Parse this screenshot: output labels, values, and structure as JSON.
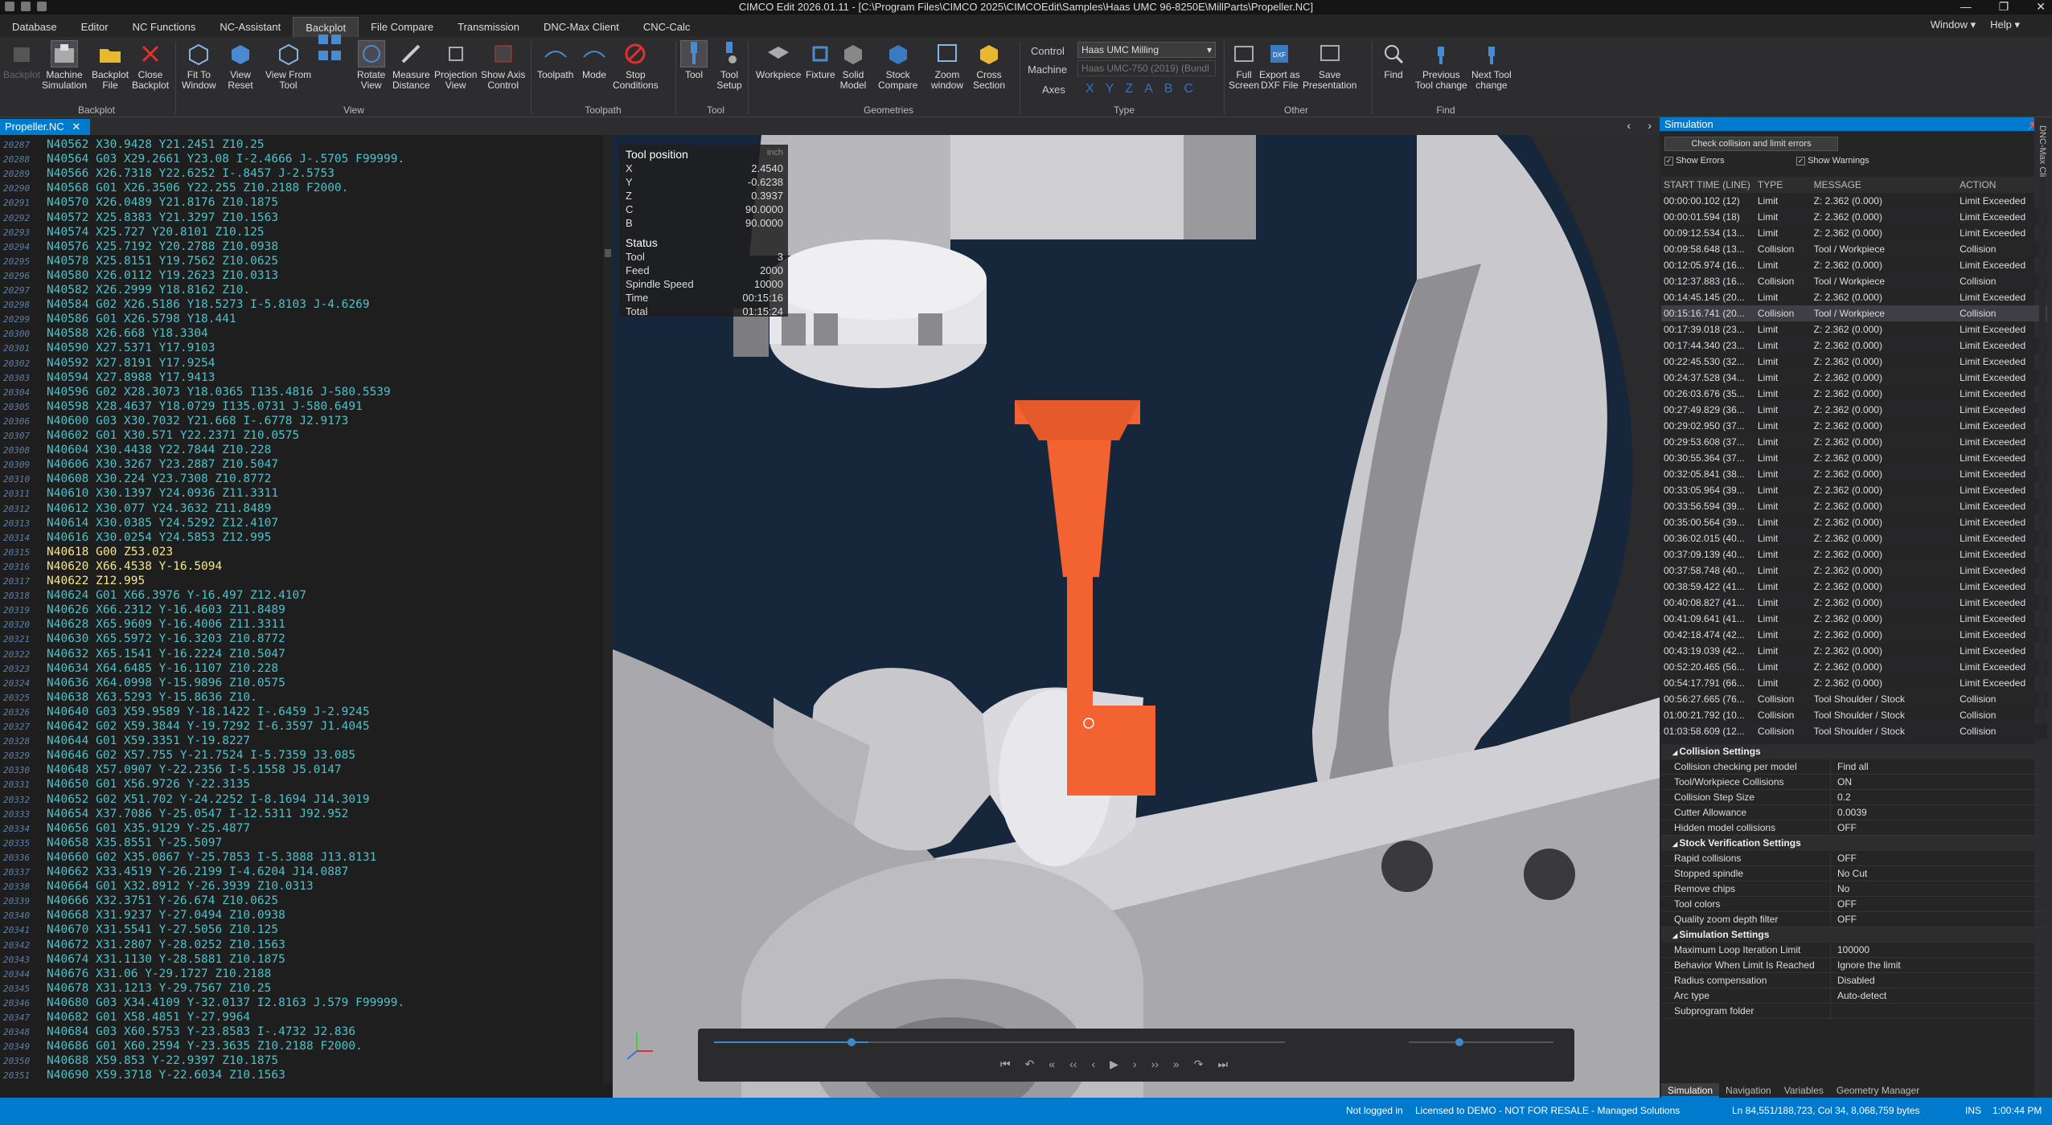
{
  "window": {
    "title": "CIMCO Edit 2026.01.11 - [C:\\Program Files\\CIMCO 2025\\CIMCOEdit\\Samples\\Haas UMC 96-8250E\\MillParts\\Propeller.NC]",
    "minimize": "—",
    "maximize": "❐",
    "close": "✕"
  },
  "menu": {
    "tabs": [
      "Database",
      "Editor",
      "NC Functions",
      "NC-Assistant",
      "Backplot",
      "File Compare",
      "Transmission",
      "DNC-Max Client",
      "CNC-Calc"
    ],
    "window_label": "Window",
    "help_label": "Help"
  },
  "ribbon": {
    "buttons": [
      {
        "label": "Backplot",
        "label2": ""
      },
      {
        "label": "Machine",
        "label2": "Simulation"
      },
      {
        "label": "Backplot",
        "label2": "File"
      },
      {
        "label": "Close",
        "label2": "Backplot"
      },
      {
        "label": "Fit To",
        "label2": "Window"
      },
      {
        "label": "View",
        "label2": "Reset"
      },
      {
        "label": "View From",
        "label2": "Tool"
      },
      {
        "label": "Rotate",
        "label2": "View"
      },
      {
        "label": "Measure",
        "label2": "Distance"
      },
      {
        "label": "Projection",
        "label2": "View"
      },
      {
        "label": "Show Axis",
        "label2": "Control"
      },
      {
        "label": "Toolpath",
        "label2": ""
      },
      {
        "label": "Mode",
        "label2": ""
      },
      {
        "label": "Stop",
        "label2": "Conditions"
      },
      {
        "label": "Tool",
        "label2": ""
      },
      {
        "label": "Tool",
        "label2": "Setup"
      },
      {
        "label": "Workpiece",
        "label2": ""
      },
      {
        "label": "Fixture",
        "label2": ""
      },
      {
        "label": "Solid",
        "label2": "Model"
      },
      {
        "label": "Stock",
        "label2": "Compare"
      },
      {
        "label": "Zoom",
        "label2": "window"
      },
      {
        "label": "Cross",
        "label2": "Section"
      },
      {
        "label": "Full",
        "label2": "Screen"
      },
      {
        "label": "Export as",
        "label2": "DXF File"
      },
      {
        "label": "Save",
        "label2": "Presentation"
      },
      {
        "label": "Find",
        "label2": ""
      },
      {
        "label": "Previous",
        "label2": "Tool change"
      },
      {
        "label": "Next Tool",
        "label2": "change"
      }
    ],
    "groups": [
      "Backplot",
      "View",
      "Toolpath",
      "Tool",
      "Geometries",
      "Type",
      "Other",
      "Find"
    ],
    "control_label": "Control",
    "control_value": "Haas UMC Milling",
    "machine_label": "Machine",
    "machine_value": "Haas UMC-750 (2019) (Bundl",
    "axes_label": "Axes",
    "axes": [
      "X",
      "Y",
      "Z",
      "A",
      "B",
      "C"
    ]
  },
  "editor": {
    "tab": "Propeller.NC",
    "close": "✕",
    "lines": [
      {
        "n": "20287",
        "t": "N40562 X30.9428 Y21.2451 Z10.25",
        "y": false
      },
      {
        "n": "20288",
        "t": "N40564 G03 X29.2661 Y23.08 I-2.4666 J-.5705 F99999.",
        "y": false
      },
      {
        "n": "20289",
        "t": "N40566 X26.7318 Y22.6252 I-.8457 J-2.5753",
        "y": false
      },
      {
        "n": "20290",
        "t": "N40568 G01 X26.3506 Y22.255 Z10.2188 F2000.",
        "y": false
      },
      {
        "n": "20291",
        "t": "N40570 X26.0489 Y21.8176 Z10.1875",
        "y": false
      },
      {
        "n": "20292",
        "t": "N40572 X25.8383 Y21.3297 Z10.1563",
        "y": false
      },
      {
        "n": "20293",
        "t": "N40574 X25.727 Y20.8101 Z10.125",
        "y": false
      },
      {
        "n": "20294",
        "t": "N40576 X25.7192 Y20.2788 Z10.0938",
        "y": false
      },
      {
        "n": "20295",
        "t": "N40578 X25.8151 Y19.7562 Z10.0625",
        "y": false
      },
      {
        "n": "20296",
        "t": "N40580 X26.0112 Y19.2623 Z10.0313",
        "y": false
      },
      {
        "n": "20297",
        "t": "N40582 X26.2999 Y18.8162 Z10.",
        "y": false
      },
      {
        "n": "20298",
        "t": "N40584 G02 X26.5186 Y18.5273 I-5.8103 J-4.6269",
        "y": false
      },
      {
        "n": "20299",
        "t": "N40586 G01 X26.5798 Y18.441",
        "y": false
      },
      {
        "n": "20300",
        "t": "N40588 X26.668 Y18.3304",
        "y": false
      },
      {
        "n": "20301",
        "t": "N40590 X27.5371 Y17.9103",
        "y": false
      },
      {
        "n": "20302",
        "t": "N40592 X27.8191 Y17.9254",
        "y": false
      },
      {
        "n": "20303",
        "t": "N40594 X27.8988 Y17.9413",
        "y": false
      },
      {
        "n": "20304",
        "t": "N40596 G02 X28.3073 Y18.0365 I135.4816 J-580.5539",
        "y": false
      },
      {
        "n": "20305",
        "t": "N40598 X28.4637 Y18.0729 I135.0731 J-580.6491",
        "y": false
      },
      {
        "n": "20306",
        "t": "N40600 G03 X30.7032 Y21.668 I-.6778 J2.9173",
        "y": false
      },
      {
        "n": "20307",
        "t": "N40602 G01 X30.571 Y22.2371 Z10.0575",
        "y": false
      },
      {
        "n": "20308",
        "t": "N40604 X30.4438 Y22.7844 Z10.228",
        "y": false
      },
      {
        "n": "20309",
        "t": "N40606 X30.3267 Y23.2887 Z10.5047",
        "y": false
      },
      {
        "n": "20310",
        "t": "N40608 X30.224 Y23.7308 Z10.8772",
        "y": false
      },
      {
        "n": "20311",
        "t": "N40610 X30.1397 Y24.0936 Z11.3311",
        "y": false
      },
      {
        "n": "20312",
        "t": "N40612 X30.077 Y24.3632 Z11.8489",
        "y": false
      },
      {
        "n": "20313",
        "t": "N40614 X30.0385 Y24.5292 Z12.4107",
        "y": false
      },
      {
        "n": "20314",
        "t": "N40616 X30.0254 Y24.5853 Z12.995",
        "y": false
      },
      {
        "n": "20315",
        "t": "N40618 G00 Z53.023",
        "y": true
      },
      {
        "n": "20316",
        "t": "N40620 X66.4538 Y-16.5094",
        "y": true
      },
      {
        "n": "20317",
        "t": "N40622 Z12.995",
        "y": true
      },
      {
        "n": "20318",
        "t": "N40624 G01 X66.3976 Y-16.497 Z12.4107",
        "y": false
      },
      {
        "n": "20319",
        "t": "N40626 X66.2312 Y-16.4603 Z11.8489",
        "y": false
      },
      {
        "n": "20320",
        "t": "N40628 X65.9609 Y-16.4006 Z11.3311",
        "y": false
      },
      {
        "n": "20321",
        "t": "N40630 X65.5972 Y-16.3203 Z10.8772",
        "y": false
      },
      {
        "n": "20322",
        "t": "N40632 X65.1541 Y-16.2224 Z10.5047",
        "y": false
      },
      {
        "n": "20323",
        "t": "N40634 X64.6485 Y-16.1107 Z10.228",
        "y": false
      },
      {
        "n": "20324",
        "t": "N40636 X64.0998 Y-15.9896 Z10.0575",
        "y": false
      },
      {
        "n": "20325",
        "t": "N40638 X63.5293 Y-15.8636 Z10.",
        "y": false
      },
      {
        "n": "20326",
        "t": "N40640 G03 X59.9589 Y-18.1422 I-.6459 J-2.9245",
        "y": false
      },
      {
        "n": "20327",
        "t": "N40642 G02 X59.3844 Y-19.7292 I-6.3597 J1.4045",
        "y": false
      },
      {
        "n": "20328",
        "t": "N40644 G01 X59.3351 Y-19.8227",
        "y": false
      },
      {
        "n": "20329",
        "t": "N40646 G02 X57.755 Y-21.7524 I-5.7359 J3.085",
        "y": false
      },
      {
        "n": "20330",
        "t": "N40648 X57.0907 Y-22.2356 I-5.1558 J5.0147",
        "y": false
      },
      {
        "n": "20331",
        "t": "N40650 G01 X56.9726 Y-22.3135",
        "y": false
      },
      {
        "n": "20332",
        "t": "N40652 G02 X51.702 Y-24.2252 I-8.1694 J14.3019",
        "y": false
      },
      {
        "n": "20333",
        "t": "N40654 X37.7086 Y-25.0547 I-12.5311 J92.952",
        "y": false
      },
      {
        "n": "20334",
        "t": "N40656 G01 X35.9129 Y-25.4877",
        "y": false
      },
      {
        "n": "20335",
        "t": "N40658 X35.8551 Y-25.5097",
        "y": false
      },
      {
        "n": "20336",
        "t": "N40660 G02 X35.0867 Y-25.7853 I-5.3888 J13.8131",
        "y": false
      },
      {
        "n": "20337",
        "t": "N40662 X33.4519 Y-26.2199 I-4.6204 J14.0887",
        "y": false
      },
      {
        "n": "20338",
        "t": "N40664 G01 X32.8912 Y-26.3939 Z10.0313",
        "y": false
      },
      {
        "n": "20339",
        "t": "N40666 X32.3751 Y-26.674 Z10.0625",
        "y": false
      },
      {
        "n": "20340",
        "t": "N40668 X31.9237 Y-27.0494 Z10.0938",
        "y": false
      },
      {
        "n": "20341",
        "t": "N40670 X31.5541 Y-27.5056 Z10.125",
        "y": false
      },
      {
        "n": "20342",
        "t": "N40672 X31.2807 Y-28.0252 Z10.1563",
        "y": false
      },
      {
        "n": "20343",
        "t": "N40674 X31.1130 Y-28.5881 Z10.1875",
        "y": false
      },
      {
        "n": "20344",
        "t": "N40676 X31.06 Y-29.1727 Z10.2188",
        "y": false
      },
      {
        "n": "20345",
        "t": "N40678 X31.1213 Y-29.7567 Z10.25",
        "y": false
      },
      {
        "n": "20346",
        "t": "N40680 G03 X34.4109 Y-32.0137 I2.8163 J.579 F99999.",
        "y": false
      },
      {
        "n": "20347",
        "t": "N40682 G01 X58.4851 Y-27.9964",
        "y": false
      },
      {
        "n": "20348",
        "t": "N40684 G03 X60.5753 Y-23.8583 I-.4732 J2.836",
        "y": false
      },
      {
        "n": "20349",
        "t": "N40686 G01 X60.2594 Y-23.3635 Z10.2188 F2000.",
        "y": false
      },
      {
        "n": "20350",
        "t": "N40688 X59.853 Y-22.9397 Z10.1875",
        "y": false
      },
      {
        "n": "20351",
        "t": "N40690 X59.3718 Y-22.6034 Z10.1563",
        "y": false
      }
    ]
  },
  "toolpos": {
    "title": "Tool position",
    "unit": "inch",
    "rows": [
      [
        "X",
        "2.4540"
      ],
      [
        "Y",
        "-0.6238"
      ],
      [
        "Z",
        "0.3937"
      ],
      [
        "C",
        "90.0000"
      ],
      [
        "B",
        "90.0000"
      ]
    ],
    "status_title": "Status",
    "status": [
      [
        "Tool",
        "3"
      ],
      [
        "Feed",
        "2000"
      ],
      [
        "Spindle Speed",
        "10000"
      ],
      [
        "Time",
        "00:15:16"
      ],
      [
        "Total",
        "01:15:24"
      ]
    ]
  },
  "simulation": {
    "title": "Simulation",
    "check_button": "Check collision and limit errors",
    "show_errors": "Show Errors",
    "show_warnings": "Show Warnings",
    "side_tab": "DNC-Max Client",
    "columns": [
      "START TIME (LINE)",
      "TYPE",
      "MESSAGE",
      "ACTION"
    ],
    "rows": [
      [
        "00:00:00.102 (12)",
        "Limit",
        "Z: 2.362 (0.000)",
        "Limit Exceeded"
      ],
      [
        "00:00:01.594 (18)",
        "Limit",
        "Z: 2.362 (0.000)",
        "Limit Exceeded"
      ],
      [
        "00:09:12.534 (13...",
        "Limit",
        "Z: 2.362 (0.000)",
        "Limit Exceeded"
      ],
      [
        "00:09:58.648 (13...",
        "Collision",
        "Tool / Workpiece",
        "Collision"
      ],
      [
        "00:12:05.974 (16...",
        "Limit",
        "Z: 2.362 (0.000)",
        "Limit Exceeded"
      ],
      [
        "00:12:37.883 (16...",
        "Collision",
        "Tool / Workpiece",
        "Collision"
      ],
      [
        "00:14:45.145 (20...",
        "Limit",
        "Z: 2.362 (0.000)",
        "Limit Exceeded"
      ],
      [
        "00:15:16.741 (20...",
        "Collision",
        "Tool / Workpiece",
        "Collision"
      ],
      [
        "00:17:39.018 (23...",
        "Limit",
        "Z: 2.362 (0.000)",
        "Limit Exceeded"
      ],
      [
        "00:17:44.340 (23...",
        "Limit",
        "Z: 2.362 (0.000)",
        "Limit Exceeded"
      ],
      [
        "00:22:45.530 (32...",
        "Limit",
        "Z: 2.362 (0.000)",
        "Limit Exceeded"
      ],
      [
        "00:24:37.528 (34...",
        "Limit",
        "Z: 2.362 (0.000)",
        "Limit Exceeded"
      ],
      [
        "00:26:03.676 (35...",
        "Limit",
        "Z: 2.362 (0.000)",
        "Limit Exceeded"
      ],
      [
        "00:27:49.829 (36...",
        "Limit",
        "Z: 2.362 (0.000)",
        "Limit Exceeded"
      ],
      [
        "00:29:02.950 (37...",
        "Limit",
        "Z: 2.362 (0.000)",
        "Limit Exceeded"
      ],
      [
        "00:29:53.608 (37...",
        "Limit",
        "Z: 2.362 (0.000)",
        "Limit Exceeded"
      ],
      [
        "00:30:55.364 (37...",
        "Limit",
        "Z: 2.362 (0.000)",
        "Limit Exceeded"
      ],
      [
        "00:32:05.841 (38...",
        "Limit",
        "Z: 2.362 (0.000)",
        "Limit Exceeded"
      ],
      [
        "00:33:05.964 (39...",
        "Limit",
        "Z: 2.362 (0.000)",
        "Limit Exceeded"
      ],
      [
        "00:33:56.594 (39...",
        "Limit",
        "Z: 2.362 (0.000)",
        "Limit Exceeded"
      ],
      [
        "00:35:00.564 (39...",
        "Limit",
        "Z: 2.362 (0.000)",
        "Limit Exceeded"
      ],
      [
        "00:36:02.015 (40...",
        "Limit",
        "Z: 2.362 (0.000)",
        "Limit Exceeded"
      ],
      [
        "00:37:09.139 (40...",
        "Limit",
        "Z: 2.362 (0.000)",
        "Limit Exceeded"
      ],
      [
        "00:37:58.748 (40...",
        "Limit",
        "Z: 2.362 (0.000)",
        "Limit Exceeded"
      ],
      [
        "00:38:59.422 (41...",
        "Limit",
        "Z: 2.362 (0.000)",
        "Limit Exceeded"
      ],
      [
        "00:40:08.827 (41...",
        "Limit",
        "Z: 2.362 (0.000)",
        "Limit Exceeded"
      ],
      [
        "00:41:09.641 (41...",
        "Limit",
        "Z: 2.362 (0.000)",
        "Limit Exceeded"
      ],
      [
        "00:42:18.474 (42...",
        "Limit",
        "Z: 2.362 (0.000)",
        "Limit Exceeded"
      ],
      [
        "00:43:19.039 (42...",
        "Limit",
        "Z: 2.362 (0.000)",
        "Limit Exceeded"
      ],
      [
        "00:52:20.465 (56...",
        "Limit",
        "Z: 2.362 (0.000)",
        "Limit Exceeded"
      ],
      [
        "00:54:17.791 (66...",
        "Limit",
        "Z: 2.362 (0.000)",
        "Limit Exceeded"
      ],
      [
        "00:56:27.665 (76...",
        "Collision",
        "Tool Shoulder / Stock",
        "Collision"
      ],
      [
        "01:00:21.792 (10...",
        "Collision",
        "Tool Shoulder / Stock",
        "Collision"
      ],
      [
        "01:03:58.609 (12...",
        "Collision",
        "Tool Shoulder / Stock",
        "Collision"
      ]
    ],
    "selected_row": 7,
    "sections": [
      {
        "title": "Collision Settings",
        "rows": [
          [
            "Collision checking per model",
            "Find all"
          ],
          [
            "Tool/Workpiece Collisions",
            "ON"
          ],
          [
            "Collision Step Size",
            "0.2"
          ],
          [
            "Cutter Allowance",
            "0.0039"
          ],
          [
            "Hidden model collisions",
            "OFF"
          ]
        ]
      },
      {
        "title": "Stock Verification Settings",
        "rows": [
          [
            "Rapid collisions",
            "OFF"
          ],
          [
            "Stopped spindle",
            "No Cut"
          ],
          [
            "Remove chips",
            "No"
          ],
          [
            "Tool colors",
            "OFF"
          ],
          [
            "Quality zoom depth filter",
            "OFF"
          ]
        ]
      },
      {
        "title": "Simulation Settings",
        "rows": [
          [
            "Maximum Loop Iteration Limit",
            "100000"
          ],
          [
            "Behavior When Limit Is Reached",
            "Ignore the limit"
          ],
          [
            "Radius compensation",
            "Disabled"
          ],
          [
            "Arc type",
            "Auto-detect"
          ],
          [
            "Subprogram folder",
            ""
          ]
        ]
      }
    ],
    "bottom_tabs": [
      "Simulation",
      "Navigation",
      "Variables",
      "Geometry Manager"
    ]
  },
  "status": {
    "login": "Not logged in",
    "license": "Licensed to DEMO - NOT FOR RESALE - Managed Solutions",
    "position": "Ln 84,551/188,723, Col 34, 8,068,759 bytes",
    "mode": "INS",
    "time": "1:00:44 PM"
  },
  "colors": {
    "accent": "#007acc",
    "tool": "#f26331",
    "code": "#4fc1c9",
    "code_rapid": "#f3e68b"
  }
}
